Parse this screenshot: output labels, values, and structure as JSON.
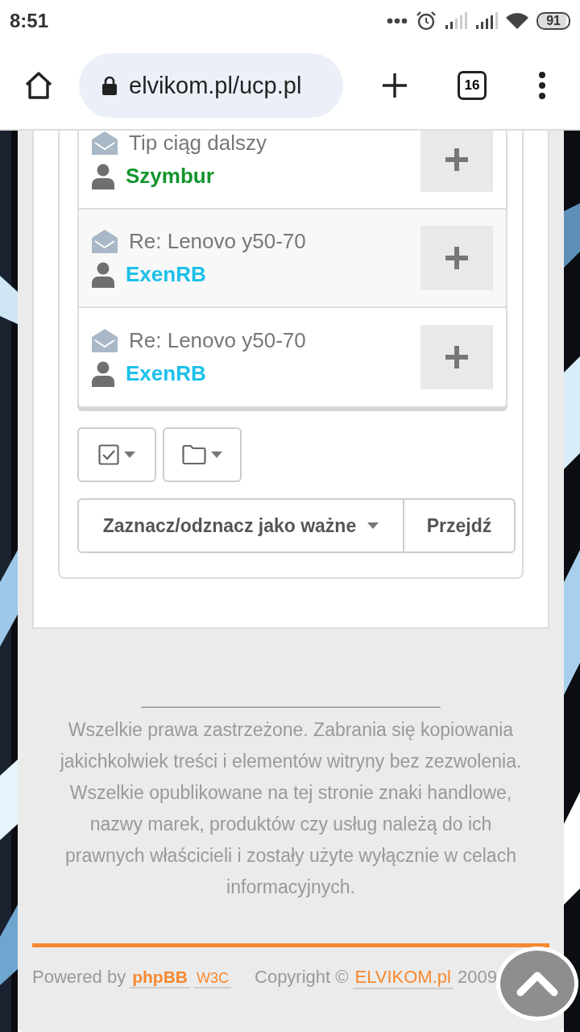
{
  "status_bar": {
    "time": "8:51",
    "battery": "91"
  },
  "browser": {
    "url": "elvikom.pl/ucp.pl",
    "tab_count": "16"
  },
  "messages": [
    {
      "title": "Tip ciąg dalszy",
      "author": "Szymbur",
      "color": "#11952e"
    },
    {
      "title": "Re: Lenovo y50-70",
      "author": "ExenRB",
      "color": "#1dc0ea"
    },
    {
      "title": "Re: Lenovo y50-70",
      "author": "ExenRB",
      "color": "#1dc0ea"
    }
  ],
  "actions": {
    "select": "Zaznacz/odznacz jako ważne",
    "go": "Przejdź"
  },
  "footer": {
    "rule": "_____________________________",
    "paragraphs": [
      "Wszelkie prawa zastrzeżone. Zabrania się kopiowania jakichkolwiek treści i elementów witryny bez zezwolenia.",
      "Wszelkie opublikowane na tej stronie znaki handlowe, nazwy marek, produktów czy usług należą do ich prawnych właścicieli i zostały użyte wyłącznie w celach informacyjnych."
    ],
    "powered_by": "Powered by",
    "phpbb": "phpBB",
    "w3c": "W3C",
    "copyright": "Copyright ©",
    "site": "ELVIKOM.pl",
    "year": "2009"
  }
}
